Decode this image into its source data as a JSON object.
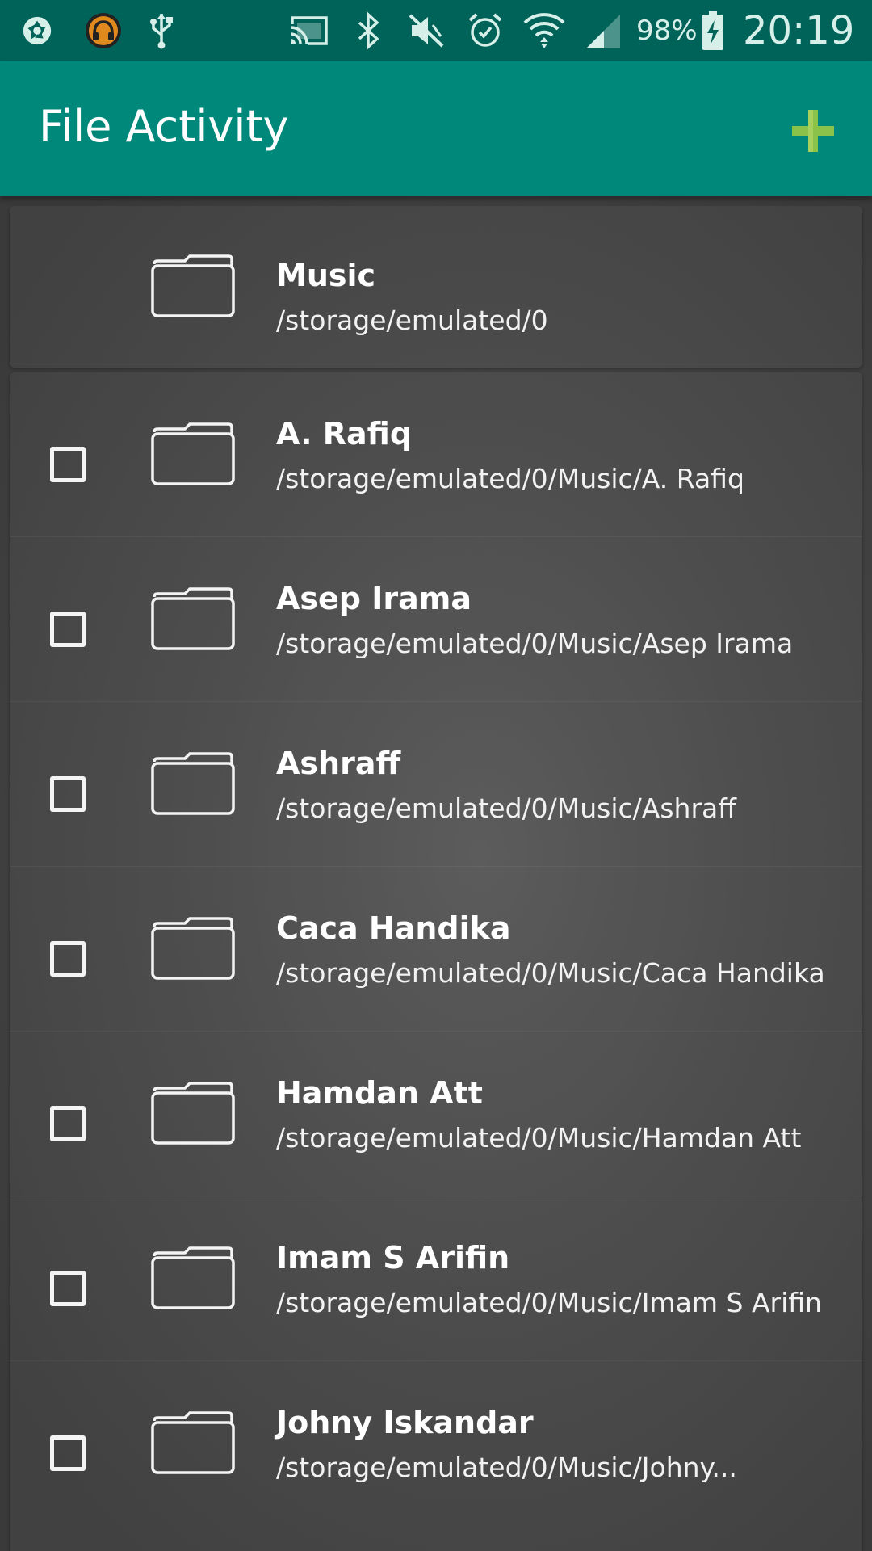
{
  "status_bar": {
    "battery_percent": "98%",
    "time": "20:19",
    "icons": [
      "aperture-icon",
      "headphones-app-icon",
      "usb-icon",
      "cast-icon",
      "bluetooth-icon",
      "mute-icon",
      "alarm-icon",
      "wifi-icon",
      "cell-signal-icon",
      "battery-charging-icon"
    ]
  },
  "app_bar": {
    "title": "File Activity",
    "add_icon": "plus-icon",
    "add_color": "#8bc34a"
  },
  "colors": {
    "status_bar": "#00635a",
    "app_bar": "#00897b",
    "background": "#474747"
  },
  "parent": {
    "name": "Music",
    "path": "/storage/emulated/0"
  },
  "folders": [
    {
      "name": "A. Rafiq",
      "path": "/storage/emulated/0/Music/A. Rafiq"
    },
    {
      "name": "Asep Irama",
      "path": "/storage/emulated/0/Music/Asep Irama"
    },
    {
      "name": "Ashraff",
      "path": "/storage/emulated/0/Music/Ashraff"
    },
    {
      "name": "Caca Handika",
      "path": "/storage/emulated/0/Music/Caca Handika"
    },
    {
      "name": "Hamdan Att",
      "path": "/storage/emulated/0/Music/Hamdan Att"
    },
    {
      "name": "Imam S Arifin",
      "path": "/storage/emulated/0/Music/Imam S Arifin"
    },
    {
      "name": "Johny Iskandar",
      "path": "/storage/emulated/0/Music/Johny..."
    }
  ]
}
